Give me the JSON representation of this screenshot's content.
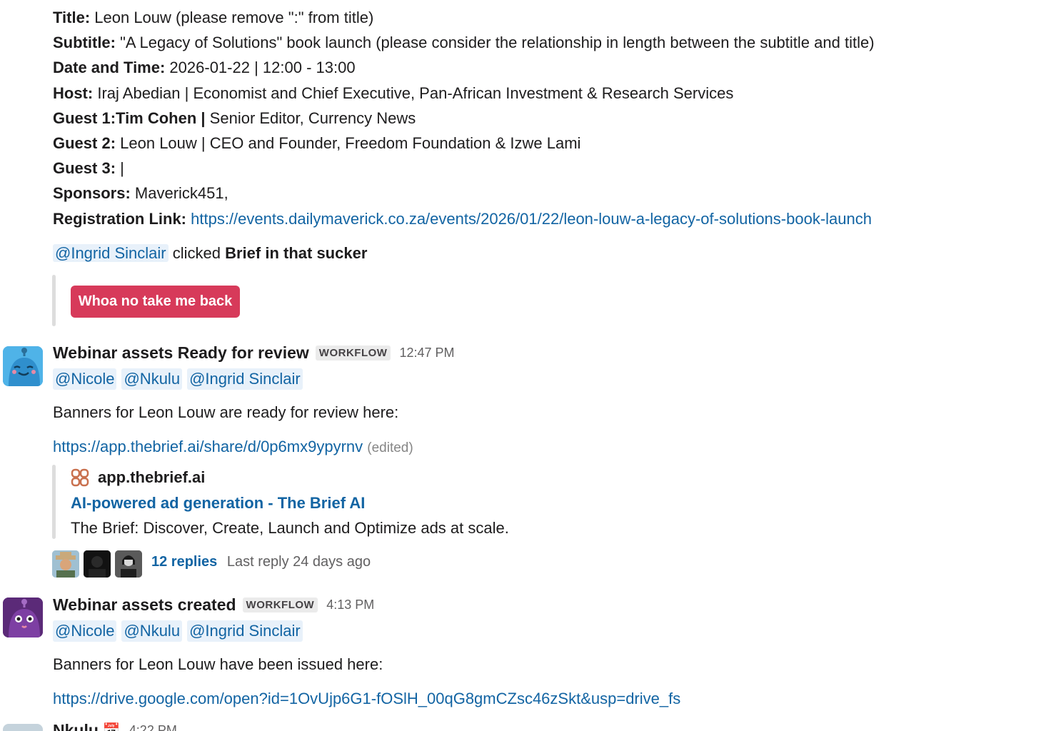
{
  "brief": {
    "title_label": "Title:",
    "title_value": " Leon Louw (please remove \":\" from title)",
    "subtitle_label": "Subtitle:",
    "subtitle_value": " \"A Legacy of Solutions\" book launch (please consider the relationship in length between the subtitle and title)",
    "datetime_label": "Date and Time:",
    "datetime_value": " 2026-01-22 | 12:00 - 13:00",
    "host_label": "Host:",
    "host_value": " Iraj Abedian |  Economist and Chief Executive, Pan-African Investment & Research Services",
    "guest1_label": "Guest 1:Tim Cohen |",
    "guest1_value": " Senior Editor, Currency News",
    "guest2_label": "Guest 2:",
    "guest2_value": " Leon Louw | CEO and Founder, Freedom Foundation & Izwe Lami",
    "guest3_label": "Guest 3:",
    "guest3_value": " |",
    "sponsors_label": "Sponsors:",
    "sponsors_value": " Maverick451,",
    "registration_label": "Registration Link:",
    "registration_url": "https://events.dailymaverick.co.za/events/2026/01/22/leon-louw-a-legacy-of-solutions-book-launch"
  },
  "click_note": {
    "mention": "@Ingrid Sinclair",
    "text": " clicked ",
    "action": "Brief in that sucker",
    "button_label": "Whoa no take me back"
  },
  "message1": {
    "sender": "Webinar assets Ready for review",
    "badge": "WORKFLOW",
    "time": "12:47 PM",
    "mentions": [
      "@Nicole",
      "@Nkulu",
      "@Ingrid Sinclair"
    ],
    "body": "Banners for Leon Louw are ready for review here:",
    "link": "https://app.thebrief.ai/share/d/0p6mx9ypyrnv",
    "edited": "(edited)",
    "unfurl": {
      "site": "app.thebrief.ai",
      "title": "AI-powered ad generation - The Brief AI",
      "description": "The Brief: Discover, Create, Launch and Optimize ads at scale."
    },
    "thread": {
      "replies": "12 replies",
      "last_reply": "Last reply 24 days ago"
    }
  },
  "message2": {
    "sender": "Webinar assets created",
    "badge": "WORKFLOW",
    "time": "4:13 PM",
    "mentions": [
      "@Nicole",
      "@Nkulu",
      "@Ingrid Sinclair"
    ],
    "body": "Banners for Leon Louw have been issued here:",
    "link": "https://drive.google.com/open?id=1OvUjp6G1-fOSlH_00qG8gmCZsc46zSkt&usp=drive_fs"
  },
  "message3": {
    "sender": "Nkulu",
    "time": "4:22 PM"
  },
  "colors": {
    "link": "#1264a3",
    "mention_bg": "#e8f1fa",
    "button_red": "#d73a5a",
    "bot1_blue": "#4fb3e8",
    "bot2_purple": "#5b2a78"
  }
}
